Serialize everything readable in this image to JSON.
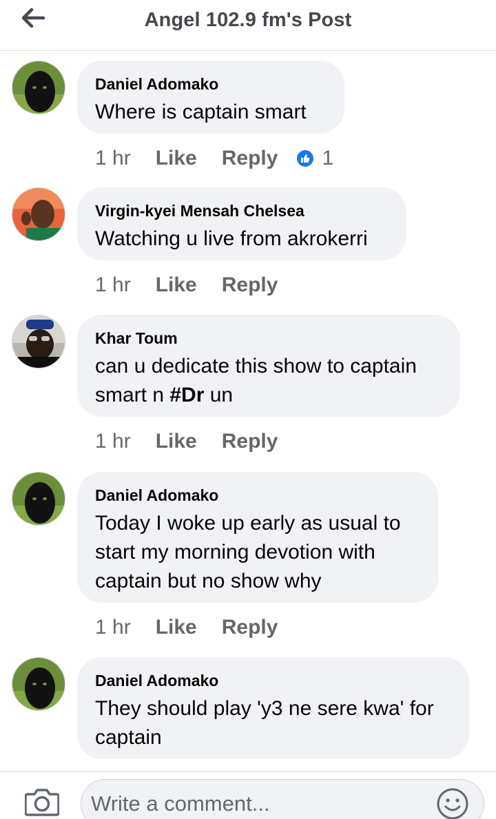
{
  "header": {
    "title": "Angel 102.9 fm's Post",
    "back_icon": "arrow-left-icon"
  },
  "comments": [
    {
      "author": "Daniel Adomako",
      "text": "Where is captain smart",
      "time": "1 hr",
      "like_label": "Like",
      "reply_label": "Reply",
      "like_count": "1"
    },
    {
      "author": "Virgin-kyei Mensah Chelsea",
      "text": "Watching u live from akrokerri",
      "time": "1 hr",
      "like_label": "Like",
      "reply_label": "Reply"
    },
    {
      "author": "Khar Toum",
      "text_line1": "can u dedicate this show to captain",
      "text_line2_pre": "smart n ",
      "text_line2_bold": "#Dr",
      "text_line2_post": " un",
      "time": "1 hr",
      "like_label": "Like",
      "reply_label": "Reply"
    },
    {
      "author": "Daniel Adomako",
      "text_line1": "Today I woke up early as usual to",
      "text_line2": "start my morning devotion with",
      "text_line3": "captain but no show why",
      "time": "1 hr",
      "like_label": "Like",
      "reply_label": "Reply"
    },
    {
      "author": "Daniel Adomako",
      "text_line1": "They should play 'y3 ne sere kwa' for",
      "text_line2": "captain"
    }
  ],
  "composer": {
    "placeholder": "Write a comment...",
    "camera_icon": "camera-icon",
    "emoji_icon": "emoji-icon"
  },
  "colors": {
    "bubble": "#f0f2f5",
    "meta_text": "#65676b",
    "like_blue": "#1877f2",
    "header_text": "#444950"
  }
}
